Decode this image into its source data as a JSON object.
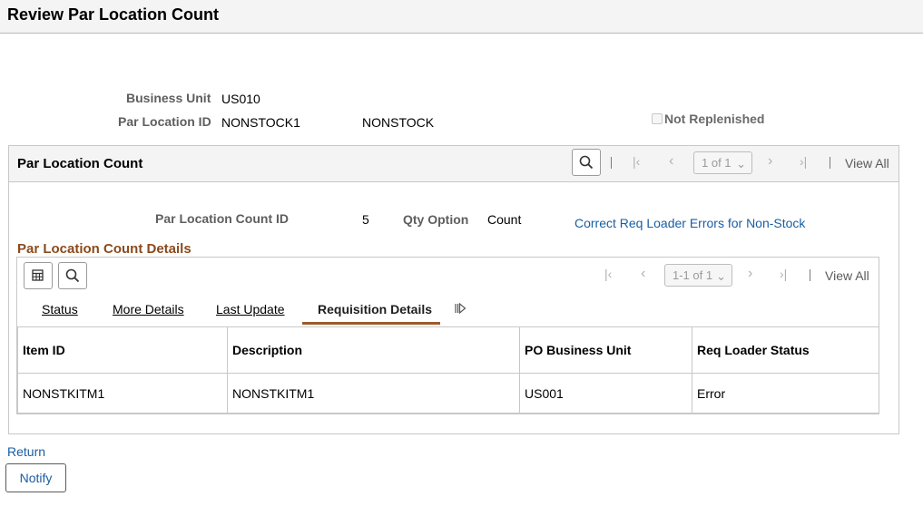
{
  "page": {
    "title": "Review Par Location Count"
  },
  "header_fields": {
    "business_unit_label": "Business Unit",
    "business_unit_value": "US010",
    "par_location_id_label": "Par Location ID",
    "par_location_id_value": "NONSTOCK1",
    "par_location_desc": "NONSTOCK",
    "not_replenished_label": "Not Replenished",
    "not_replenished_checked": false
  },
  "par_count_box": {
    "title": "Par Location Count",
    "pager_text": "1 of 1",
    "view_all": "View All",
    "count_id_label": "Par Location Count ID",
    "count_id_value": "5",
    "qty_option_label": "Qty Option",
    "qty_option_value": "Count",
    "correct_link": "Correct Req Loader Errors for Non-Stock"
  },
  "details": {
    "title": "Par Location Count Details",
    "pager_text": "1-1 of 1",
    "view_all": "View All",
    "tabs": [
      {
        "label": "Status",
        "active": false
      },
      {
        "label": "More Details",
        "active": false
      },
      {
        "label": "Last Update",
        "active": false
      },
      {
        "label": "Requisition Details",
        "active": true
      }
    ],
    "columns": [
      "Item ID",
      "Description",
      "PO Business Unit",
      "Req Loader Status"
    ],
    "rows": [
      [
        "NONSTKITM1",
        "NONSTKITM1",
        "US001",
        "Error"
      ]
    ]
  },
  "footer": {
    "return_link": "Return",
    "notify_button": "Notify"
  },
  "colors": {
    "accent_brown": "#8b4a1d",
    "link_blue": "#1a5ea3"
  }
}
